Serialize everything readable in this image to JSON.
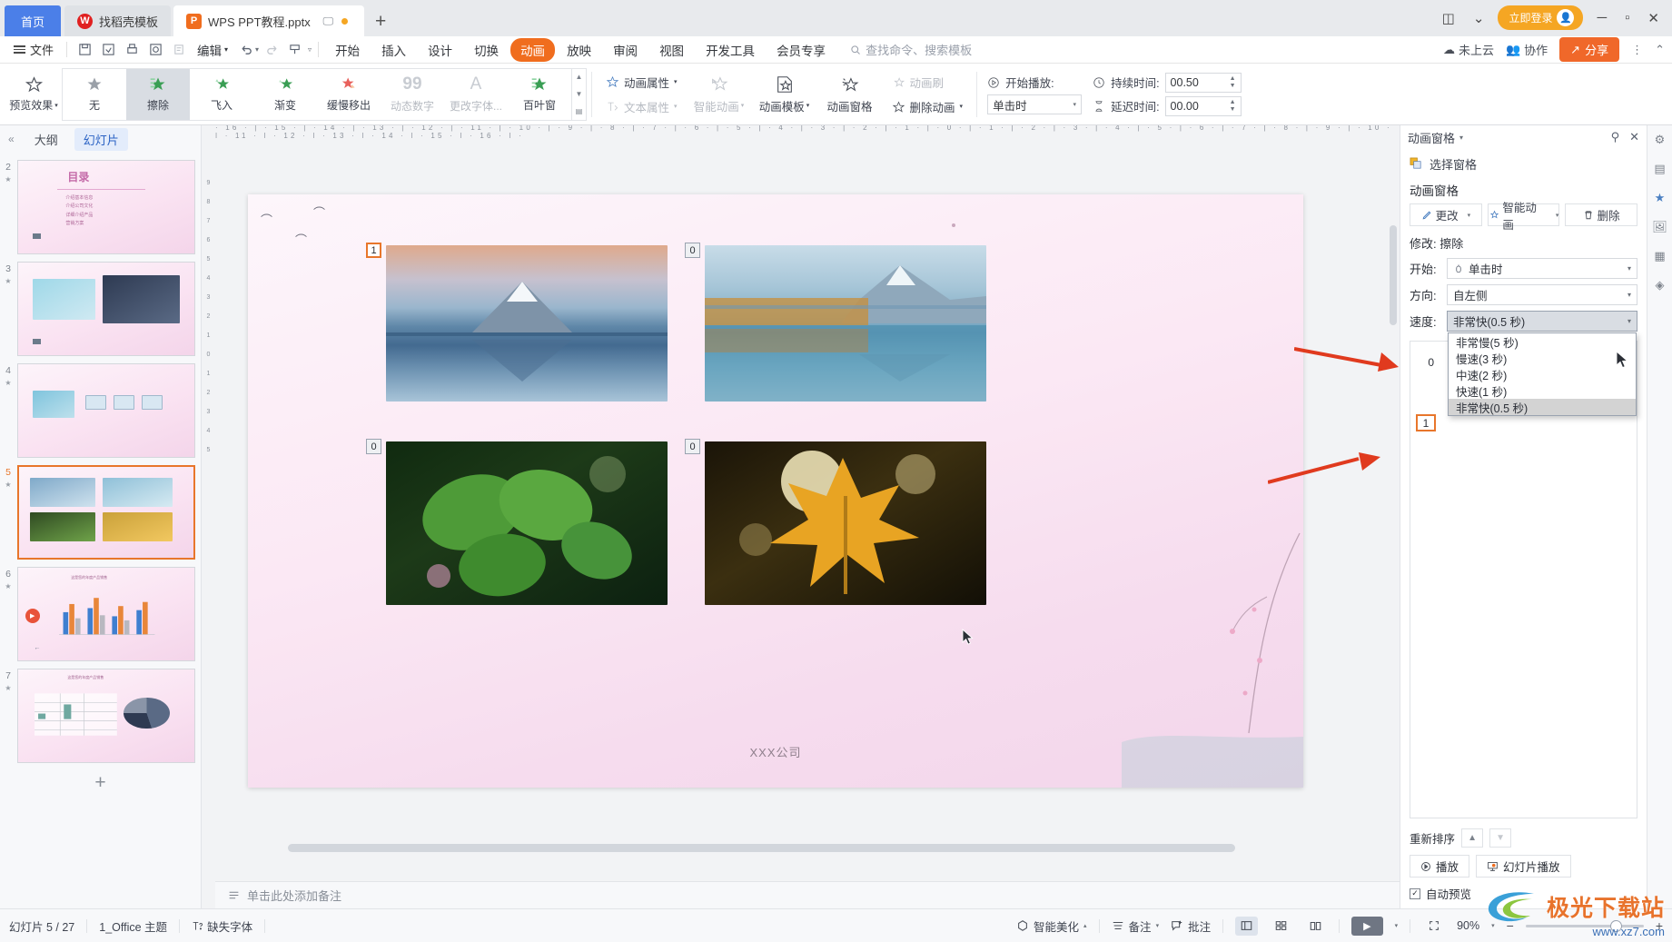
{
  "tabbar": {
    "home": "首页",
    "tabs": [
      {
        "label": "找稻壳模板",
        "icon": "docer-icon",
        "active": false
      },
      {
        "label": "WPS PPT教程.pptx",
        "icon": "ppt-icon",
        "active": true
      }
    ],
    "new_tab": "+",
    "login": "立即登录"
  },
  "menu": {
    "file": "文件",
    "edit": "编辑",
    "items": [
      "开始",
      "插入",
      "设计",
      "切换",
      "动画",
      "放映",
      "审阅",
      "视图",
      "开发工具",
      "会员专享"
    ],
    "selected": "动画",
    "search_placeholder": "查找命令、搜索模板",
    "cloud_status": "未上云",
    "collab": "协作",
    "share": "分享"
  },
  "ribbon": {
    "preview": "预览效果",
    "gallery": [
      {
        "label": "无",
        "dim": false
      },
      {
        "label": "擦除",
        "dim": false,
        "selected": true
      },
      {
        "label": "飞入",
        "dim": false
      },
      {
        "label": "渐变",
        "dim": false
      },
      {
        "label": "缓慢移出",
        "dim": false
      },
      {
        "label": "动态数字",
        "dim": true
      },
      {
        "label": "更改字体...",
        "dim": true
      },
      {
        "label": "百叶窗",
        "dim": false
      }
    ],
    "anim_property": "动画属性",
    "text_property": "文本属性",
    "smart_anim": "智能动画",
    "anim_template": "动画模板",
    "anim_pane": "动画窗格",
    "delete_anim": "删除动画",
    "anim_brush": "动画刷",
    "start_play_label": "开始播放:",
    "start_play_value": "单击时",
    "duration_label": "持续时间:",
    "duration_value": "00.50",
    "delay_label": "延迟时间:",
    "delay_value": "00.00"
  },
  "sidebar": {
    "tabs": [
      "大纲",
      "幻灯片"
    ],
    "selected_tab": "幻灯片",
    "slides": [
      {
        "num": "2",
        "selected": false,
        "kind": "toc",
        "title": "目录",
        "bullets": [
          "介绍基本信息",
          "介绍公司文化",
          "详细介绍产品",
          "营销方案"
        ]
      },
      {
        "num": "3",
        "selected": false,
        "kind": "two-img"
      },
      {
        "num": "4",
        "selected": false,
        "kind": "flow"
      },
      {
        "num": "5",
        "selected": true,
        "kind": "four-img"
      },
      {
        "num": "6",
        "selected": false,
        "kind": "bar-chart"
      },
      {
        "num": "7",
        "selected": false,
        "kind": "table-pie"
      }
    ],
    "add": "+"
  },
  "canvas": {
    "ruler_h": "· 16 · | · 15 · | · 14 · | · 13 · | · 12 · | · 11 · | · 10 · | · 9 · | · 8 · | · 7 · | · 6 · | · 5 · | · 4 · | · 3 · | · 2 · | · 1 · | · 0 · | · 1 · | · 2 · | · 3 · | · 4 · | · 5 · | · 6 · | · 7 · | · 8 · | · 9 · | · 10 · | · 11 · | · 12 · | · 13 · | · 14 · | · 15 · | · 16 · | ·",
    "ruler_v": [
      "9",
      "8",
      "7",
      "6",
      "5",
      "4",
      "3",
      "2",
      "1",
      "0",
      "1",
      "2",
      "3",
      "4",
      "5",
      "6",
      "7",
      "8",
      "9"
    ],
    "badges": [
      "1",
      "0",
      "0",
      "0"
    ],
    "footer_text": "XXX公司",
    "notes_placeholder": "单击此处添加备注"
  },
  "pane": {
    "title": "动画窗格",
    "select_pane": "选择窗格",
    "section_title": "动画窗格",
    "btn_change": "更改",
    "btn_smart": "智能动画",
    "btn_delete": "删除",
    "modify_label": "修改: 擦除",
    "start_label": "开始:",
    "start_value": "单击时",
    "direction_label": "方向:",
    "direction_value": "自左侧",
    "speed_label": "速度:",
    "speed_value": "非常快(0.5 秒)",
    "speed_options": [
      "非常慢(5 秒)",
      "慢速(3 秒)",
      "中速(2 秒)",
      "快速(1 秒)",
      "非常快(0.5 秒)"
    ],
    "speed_selected": "非常快(0.5 秒)",
    "list_items": [
      {
        "num": "0",
        "highlight": false
      },
      {
        "num": "1",
        "highlight": true
      }
    ],
    "reorder": "重新排序",
    "play": "播放",
    "slide_play": "幻灯片播放",
    "auto_preview": "自动预览"
  },
  "status": {
    "slide_count": "幻灯片 5 / 27",
    "theme": "1_Office 主题",
    "missing_font": "缺失字体",
    "beautify": "智能美化",
    "notes": "备注",
    "comments": "批注",
    "zoom": "90%"
  },
  "watermark": {
    "main": "极光下载站",
    "sub": "www.xz7.com"
  },
  "colors": {
    "accent_orange": "#f06d1e",
    "accent_blue": "#4b7fe8",
    "arrow_red": "#e03a1e"
  }
}
